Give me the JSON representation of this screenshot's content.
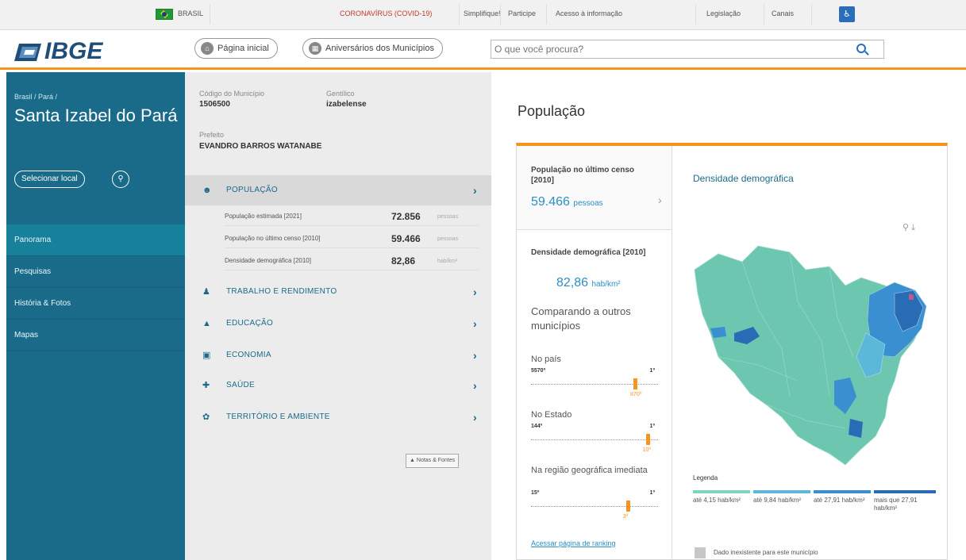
{
  "govbar": {
    "country": "BRASIL",
    "links": [
      "CORONAVÍRUS (COVID-19)",
      "Simplifique!",
      "Participe",
      "Acesso à informação",
      "Legislação",
      "Canais"
    ]
  },
  "header": {
    "logo": "IBGE",
    "home_label": "Página inicial",
    "anniversaries_label": "Aniversários dos Municípios",
    "search_placeholder": "O que você procura?"
  },
  "sidebar": {
    "breadcrumb": "Brasil / Pará /",
    "place_name": "Santa Izabel do Pará",
    "select_label": "Selecionar local",
    "nav": [
      "Panorama",
      "Pesquisas",
      "História & Fotos",
      "Mapas"
    ],
    "active_nav": "Panorama"
  },
  "municipio": {
    "code_label": "Código do Município",
    "code_value": "1506500",
    "gentilico_label": "Gentílico",
    "gentilico_value": "izabelense",
    "prefeito_label": "Prefeito",
    "prefeito_value": "EVANDRO BARROS WATANABE"
  },
  "categories": [
    {
      "label": "POPULAÇÃO",
      "icon": "people-icon"
    },
    {
      "label": "TRABALHO E RENDIMENTO",
      "icon": "worker-icon"
    },
    {
      "label": "EDUCAÇÃO",
      "icon": "graduation-cap-icon"
    },
    {
      "label": "ECONOMIA",
      "icon": "money-icon"
    },
    {
      "label": "SAÚDE",
      "icon": "health-icon"
    },
    {
      "label": "TERRITÓRIO E AMBIENTE",
      "icon": "leaf-icon"
    }
  ],
  "populacao_rows": [
    {
      "label": "População estimada [2021]",
      "value": "72.856",
      "unit": "pessoas"
    },
    {
      "label": "População no último censo [2010]",
      "value": "59.466",
      "unit": "pessoas"
    },
    {
      "label": "Densidade demográfica [2010]",
      "value": "82,86",
      "unit": "hab/km²"
    }
  ],
  "notes_label": "Notas & Fontes",
  "main": {
    "title": "População",
    "tab_label": "População no último censo [2010]",
    "tab_value": "59.466",
    "tab_unit": "pessoas",
    "density_label": "Densidade demográfica [2010]",
    "density_value": "82,86",
    "density_unit": "hab/km²",
    "compare_label": "Comparando a outros municípios",
    "rankings": [
      {
        "title": "No país",
        "left": "5570º",
        "right": "1º",
        "pos": "870º",
        "fraction": 0.84
      },
      {
        "title": "No Estado",
        "left": "144º",
        "right": "1º",
        "pos": "10º",
        "fraction": 0.94
      },
      {
        "title": "Na região geográfica imediata",
        "left": "15º",
        "right": "1º",
        "pos": "3º",
        "fraction": 0.78
      }
    ],
    "ranking_link": "Acessar página de ranking",
    "map_title": "Densidade demográfica",
    "legend_title": "Legenda",
    "legend": [
      {
        "label": "até 4,15 hab/km²",
        "color": "#7fd4c1"
      },
      {
        "label": "até 9,84 hab/km²",
        "color": "#5bb8d8"
      },
      {
        "label": "até 27,91 hab/km²",
        "color": "#3a8fd0"
      },
      {
        "label": "mais que 27,91 hab/km²",
        "color": "#2a6bb5"
      }
    ],
    "no_data_label": "Dado inexistente para este município"
  },
  "colors": {
    "sidebar": "#1a6b8a",
    "accent": "#f7941d",
    "link": "#2a8fc5",
    "map_base": "#6cc6b0"
  }
}
